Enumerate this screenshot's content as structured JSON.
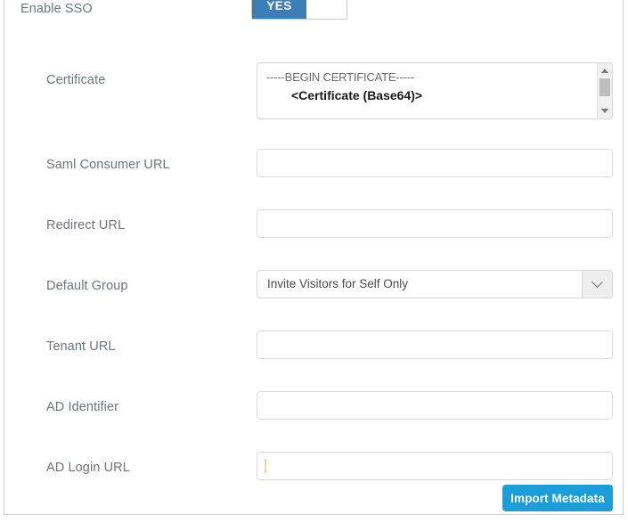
{
  "form": {
    "sso_toggle": {
      "label": "Enable SSO",
      "on_label": "YES",
      "state": "on"
    },
    "fields": [
      {
        "key": "certificate",
        "label": "Certificate",
        "type": "textarea",
        "line1": "-----BEGIN CERTIFICATE-----",
        "line2": "<Certificate (Base64)>",
        "scrollable": true
      },
      {
        "key": "saml_consumer_url",
        "label": "Saml Consumer URL",
        "type": "text",
        "value": "",
        "placeholder": ""
      },
      {
        "key": "redirect_url",
        "label": "Redirect URL",
        "type": "text",
        "value": "",
        "placeholder": ""
      },
      {
        "key": "default_group",
        "label": "Default Group",
        "type": "select",
        "value": "Invite Visitors for Self Only"
      },
      {
        "key": "tenant_url",
        "label": "Tenant URL",
        "type": "text",
        "value": "",
        "placeholder": ""
      },
      {
        "key": "ad_identifier",
        "label": "AD Identifier",
        "type": "text",
        "value": "",
        "placeholder": ""
      },
      {
        "key": "ad_login_url",
        "label": "AD Login URL",
        "type": "text",
        "value": "",
        "placeholder": "",
        "focused": true
      }
    ],
    "actions": {
      "import_metadata_label": "Import Metadata"
    }
  },
  "icons": {
    "chevron_down": "chevron-down-icon",
    "scroll_up": "scroll-up-arrow-icon",
    "scroll_down": "scroll-down-arrow-icon"
  },
  "colors": {
    "toggle_on": "#3c7eb8",
    "primary_button": "#1b9dd9",
    "label_text": "#6c757d",
    "border": "#dcdcdc",
    "caret": "#f2d58f"
  }
}
